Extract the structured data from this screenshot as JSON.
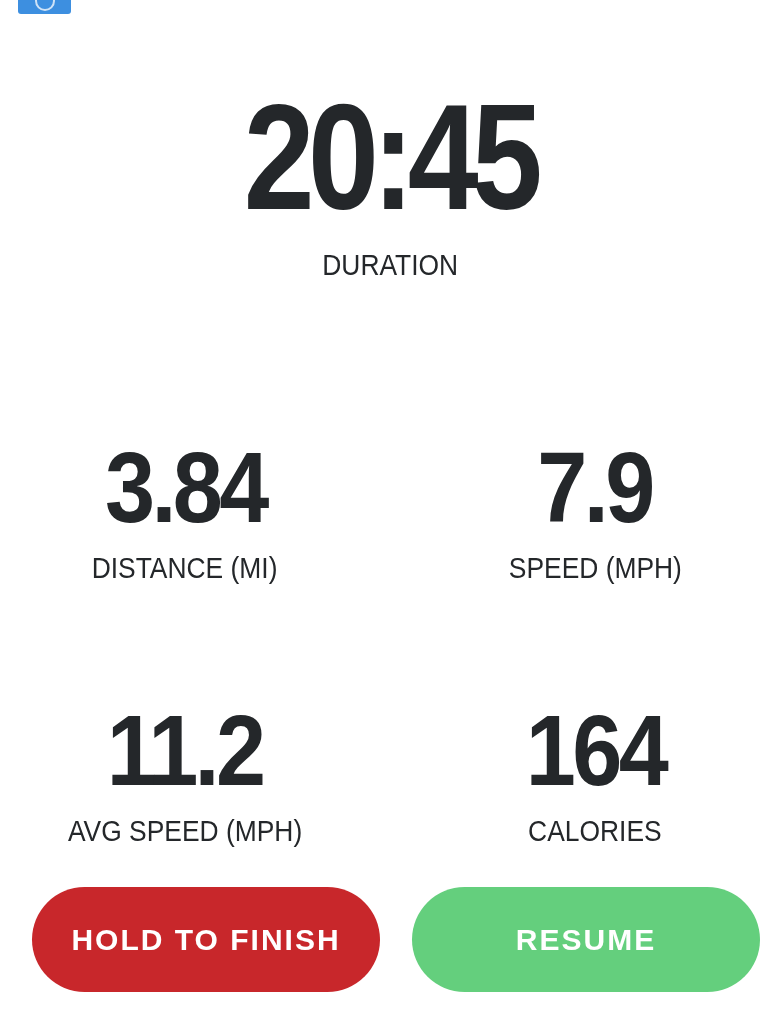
{
  "duration": {
    "value": "20:45",
    "label": "DURATION"
  },
  "stats": [
    {
      "value": "3.84",
      "label": "DISTANCE (MI)"
    },
    {
      "value": "7.9",
      "label": "SPEED (MPH)"
    },
    {
      "value": "11.2",
      "label": "AVG SPEED (MPH)"
    },
    {
      "value": "164",
      "label": "CALORIES"
    }
  ],
  "buttons": [
    {
      "label": "HOLD TO FINISH",
      "kind": "finish"
    },
    {
      "label": "RESUME",
      "kind": "resume"
    }
  ]
}
